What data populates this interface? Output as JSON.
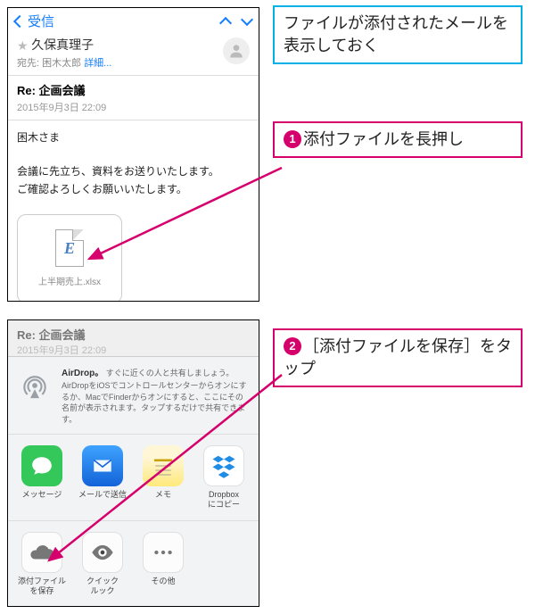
{
  "callouts": {
    "pre": "ファイルが添付されたメールを表示しておく",
    "step1": {
      "num": "❶",
      "text": "添付ファイルを長押し"
    },
    "step2": {
      "num": "❷",
      "text": "［添付ファイルを保存］をタップ"
    }
  },
  "mail": {
    "nav": {
      "back": "受信"
    },
    "sender": "久保真理子",
    "toPrefix": "宛先:",
    "toName": "困木太郎",
    "details": "詳細...",
    "subject": "Re: 企画会議",
    "date": "2015年9月3日 22:09",
    "body": {
      "greeting": "困木さま",
      "line1": "会議に先立ち、資料をお送りいたします。",
      "line2": "ご確認よろしくお願いいたします。"
    },
    "attachment": {
      "glyph": "E",
      "name": "上半期売上.xlsx"
    }
  },
  "sheet": {
    "subject": "Re: 企画会議",
    "date": "2015年9月3日 22:09",
    "airdrop": {
      "title": "AirDrop。",
      "body": "すぐに近くの人と共有しましょう。AirDropをiOSでコントロールセンターからオンにするか、MacでFinderからオンにすると、ここにその名前が表示されます。タップするだけで共有できます。"
    },
    "apps": [
      {
        "label": "メッセージ",
        "bg": "#34c759",
        "icon": "message"
      },
      {
        "label": "メールで送信",
        "bg": "#1e73e8",
        "icon": "mail"
      },
      {
        "label": "メモ",
        "bg": "#ffcc00",
        "icon": "note"
      },
      {
        "label": "Dropbox\nにコピー",
        "bg": "#ffffff",
        "icon": "dropbox"
      }
    ],
    "actions": [
      {
        "label": "添付ファイル\nを保存",
        "icon": "cloud"
      },
      {
        "label": "クイック\nルック",
        "icon": "eye"
      },
      {
        "label": "その他",
        "icon": "more"
      }
    ]
  }
}
